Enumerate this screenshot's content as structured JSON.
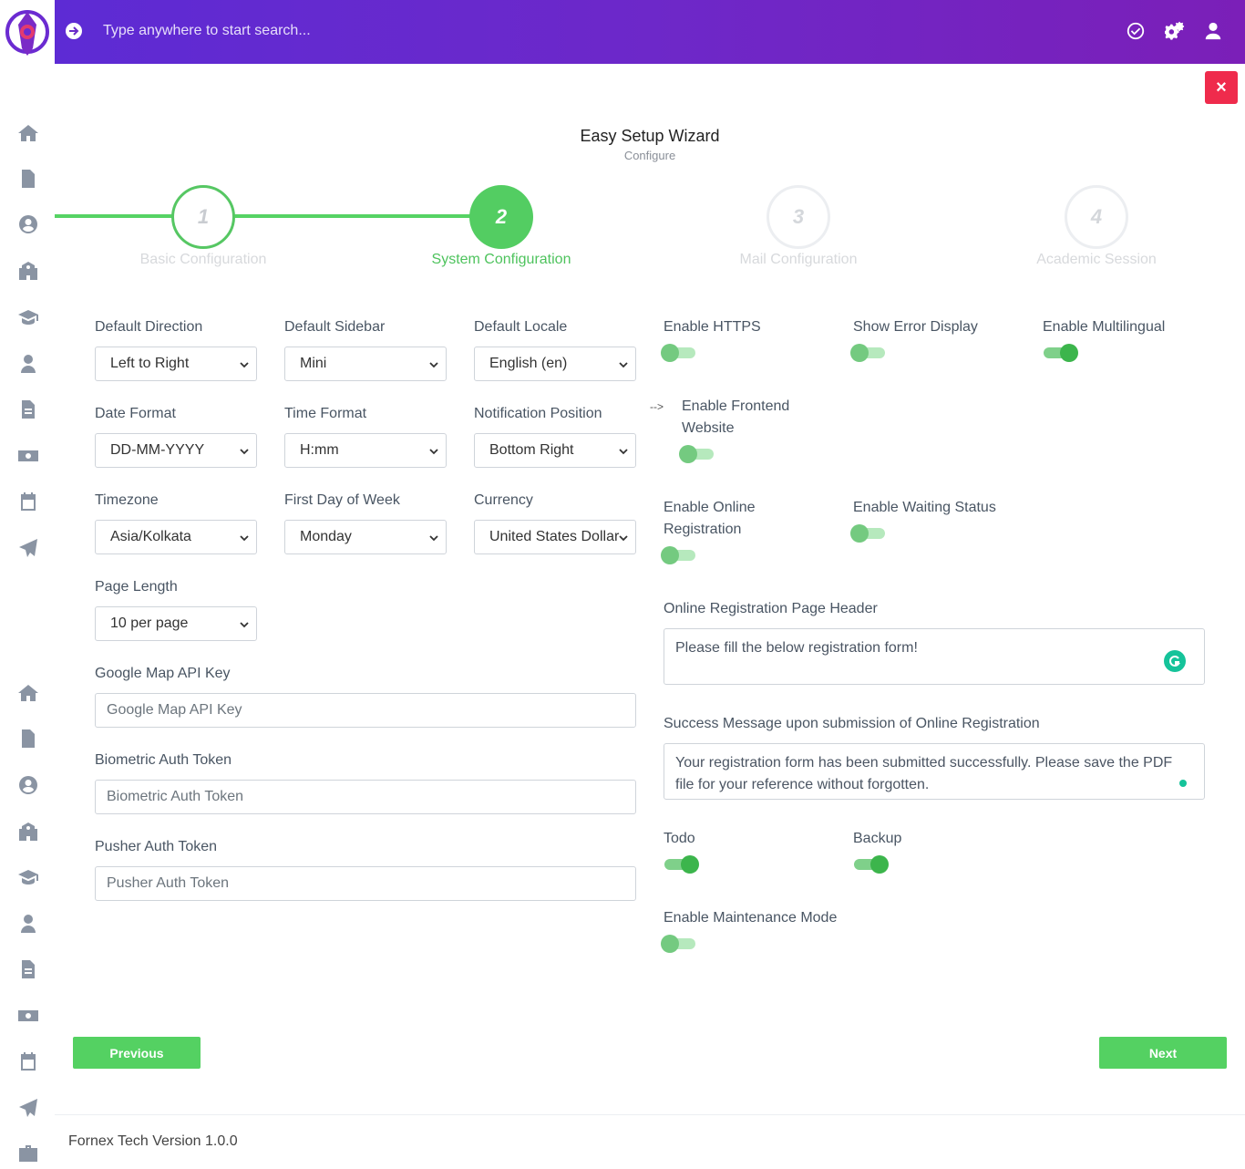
{
  "header": {
    "search_placeholder": "Type anywhere to start search..."
  },
  "wizard": {
    "title": "Easy Setup Wizard",
    "subtitle": "Configure",
    "steps": [
      {
        "number": "1",
        "label": "Basic Configuration",
        "state": "done"
      },
      {
        "number": "2",
        "label": "System Configuration",
        "state": "active"
      },
      {
        "number": "3",
        "label": "Mail Configuration",
        "state": "future"
      },
      {
        "number": "4",
        "label": "Academic Session",
        "state": "future"
      }
    ],
    "close_label": "×"
  },
  "form": {
    "default_direction": {
      "label": "Default Direction",
      "value": "Left to Right"
    },
    "default_sidebar": {
      "label": "Default Sidebar",
      "value": "Mini"
    },
    "default_locale": {
      "label": "Default Locale",
      "value": "English (en)"
    },
    "date_format": {
      "label": "Date Format",
      "value": "DD-MM-YYYY"
    },
    "time_format": {
      "label": "Time Format",
      "value": "H:mm"
    },
    "notification_position": {
      "label": "Notification Position",
      "value": "Bottom Right"
    },
    "timezone": {
      "label": "Timezone",
      "value": "Asia/Kolkata"
    },
    "first_day_of_week": {
      "label": "First Day of Week",
      "value": "Monday"
    },
    "currency": {
      "label": "Currency",
      "value": "United States Dollar"
    },
    "page_length": {
      "label": "Page Length",
      "value": "10 per page"
    },
    "google_map_api_key": {
      "label": "Google Map API Key",
      "placeholder": "Google Map API Key"
    },
    "biometric_auth_token": {
      "label": "Biometric Auth Token",
      "placeholder": "Biometric Auth Token"
    },
    "pusher_auth_token": {
      "label": "Pusher Auth Token",
      "placeholder": "Pusher Auth Token"
    }
  },
  "toggles": {
    "enable_https": {
      "label": "Enable HTTPS",
      "on": false
    },
    "show_error_display": {
      "label": "Show Error Display",
      "on": false
    },
    "enable_multilingual": {
      "label": "Enable Multilingual",
      "on": true
    },
    "arrow_note": "-->",
    "enable_frontend_website": {
      "label_line1": "Enable Frontend",
      "label_line2": "Website",
      "on": false
    },
    "enable_online_registration": {
      "label_line1": "Enable Online",
      "label_line2": "Registration",
      "on": false
    },
    "enable_waiting_status": {
      "label": "Enable Waiting Status",
      "on": false
    },
    "todo": {
      "label": "Todo",
      "on": true
    },
    "backup": {
      "label": "Backup",
      "on": true
    },
    "enable_maintenance_mode": {
      "label": "Enable Maintenance Mode",
      "on": false
    }
  },
  "registration": {
    "header_label": "Online Registration Page Header",
    "header_value": "Please fill the below registration form!",
    "success_label": "Success Message upon submission of Online Registration",
    "success_value": "Your registration form has been submitted successfully. Please save the PDF file for your reference without forgotten."
  },
  "buttons": {
    "previous": "Previous",
    "next": "Next"
  },
  "footer": {
    "text": "Fornex Tech Version 1.0.0"
  },
  "colors": {
    "accent_green": "#54d162",
    "header_gradient_start": "#5d2bd4",
    "header_gradient_end": "#7b1fb8",
    "close_red": "#ef2b4c"
  },
  "sidebar_icons": [
    "home-icon",
    "document-icon",
    "user-circle-icon",
    "school-icon",
    "graduation-cap-icon",
    "user-tie-icon",
    "file-text-icon",
    "money-icon",
    "calendar-icon",
    "send-icon",
    "home-icon",
    "document-icon",
    "user-circle-icon",
    "school-icon",
    "graduation-cap-icon",
    "user-tie-icon",
    "file-text-icon",
    "money-icon",
    "calendar-icon",
    "send-icon",
    "briefcase-icon"
  ]
}
